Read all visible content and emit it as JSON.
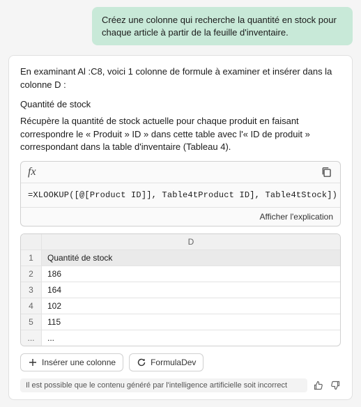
{
  "user_message": "Créez une colonne qui recherche la quantité en stock pour chaque article à partir de la feuille d'inventaire.",
  "response": {
    "intro": "En examinant Al :C8, voici 1 colonne de formule à examiner et insérer dans la colonne D :",
    "heading": "Quantité de stock",
    "desc": "Récupère la quantité de stock actuelle pour chaque produit en faisant correspondre le « Produit » ID » dans cette table avec l'« ID de produit » correspondant dans la table d'inventaire (Tableau 4)."
  },
  "formula": {
    "fx_label": "fx",
    "text": "=XLOOKUP([@[Product ID]], Table4tProduct        ID], Table4tStock])",
    "explain_label": "Afficher l'explication"
  },
  "preview": {
    "column_letter": "D",
    "header_label": "Quantité de stock",
    "rows": [
      {
        "n": "1",
        "v": "Quantité de stock"
      },
      {
        "n": "2",
        "v": "186"
      },
      {
        "n": "3",
        "v": "164"
      },
      {
        "n": "4",
        "v": "102"
      },
      {
        "n": "5",
        "v": "115"
      },
      {
        "n": "...",
        "v": "..."
      }
    ]
  },
  "actions": {
    "insert": "Insérer une colonne",
    "formula_dev": "FormulaDev"
  },
  "disclaimer": "Il est possible que le contenu généré par l'intelligence artificielle soit incorrect",
  "icons": {
    "plus": "+",
    "refresh": "↻"
  }
}
